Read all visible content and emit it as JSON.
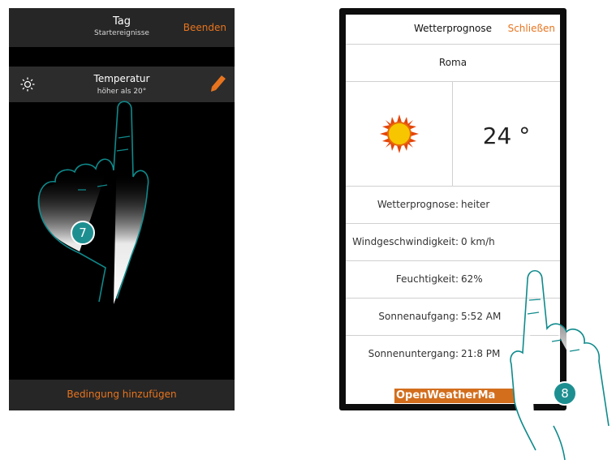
{
  "left_panel": {
    "header": {
      "title": "Tag",
      "subtitle": "Startereignisse",
      "end_button": "Beenden"
    },
    "condition": {
      "title": "Temperatur",
      "subtitle": "höher als 20°",
      "icon": "sun-outline-icon",
      "edit_icon": "pencil-icon"
    },
    "footer": {
      "add_condition": "Bedingung hinzufügen"
    },
    "step_badge": "7"
  },
  "right_panel": {
    "header": {
      "title": "Wetterprognose",
      "close_button": "Schließen"
    },
    "city": "Roma",
    "weather_icon": "sun-icon",
    "temperature": "24 °",
    "rows": [
      {
        "label": "Wetterprognose:",
        "value": "heiter"
      },
      {
        "label": "Windgeschwindigkeit:",
        "value": "0 km/h"
      },
      {
        "label": "Feuchtigkeit:",
        "value": "62%"
      },
      {
        "label": "Sonnenaufgang:",
        "value": "5:52 AM"
      },
      {
        "label": "Sonnenuntergang:",
        "value": "21:8 PM"
      }
    ],
    "provider_logo": "OpenWeatherMa",
    "step_badge": "8"
  },
  "colors": {
    "accent": "#e8741e",
    "badge": "#1e8f91",
    "header_dark": "#262626"
  }
}
